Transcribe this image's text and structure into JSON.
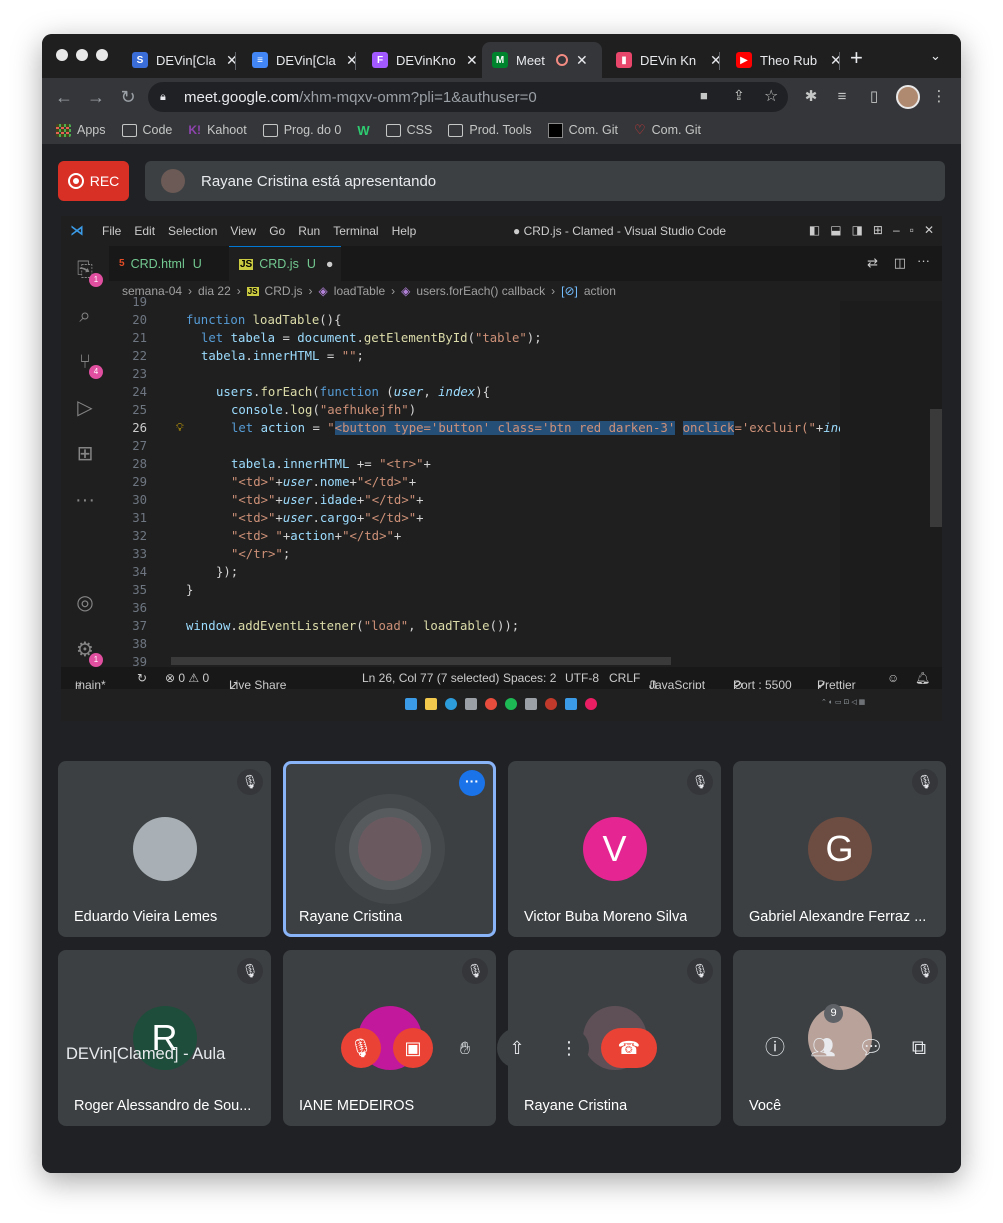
{
  "browser": {
    "tabs": [
      {
        "title": "DEVin[Cla",
        "favicon_color": "#3b6dd8",
        "favicon_glyph": "S"
      },
      {
        "title": "DEVin[Cla",
        "favicon_color": "#4285f4",
        "favicon_glyph": "≡"
      },
      {
        "title": "DEVinKno",
        "favicon_color": "#a259ff",
        "favicon_glyph": "F"
      },
      {
        "title": "Meet",
        "favicon_color": "#00832d",
        "favicon_glyph": "M"
      },
      {
        "title": "DEVin Kn",
        "favicon_color": "#e8476b",
        "favicon_glyph": "▮"
      },
      {
        "title": "Theo Rub",
        "favicon_color": "#ff0000",
        "favicon_glyph": "▶"
      }
    ],
    "new_tab": "+",
    "url_host": "meet.google.com",
    "url_path": "/xhm-mqxv-omm?pli=1&authuser=0",
    "bookmarks": [
      "Apps",
      "Code",
      "Kahoot",
      "Prog. do 0",
      "",
      "CSS",
      "Prod. Tools",
      "Com. Git",
      "Com. Git"
    ]
  },
  "meet": {
    "rec_label": "REC",
    "presenting_text": "Rayane Cristina está apresentando",
    "meeting_name": "DEVin[Clamed] - Aula",
    "participant_count": "9",
    "participants": [
      {
        "name": "Eduardo Vieira Lemes",
        "initial": "",
        "color": "#a8b0b5"
      },
      {
        "name": "Rayane Cristina",
        "initial": "",
        "color": "#6a5a60"
      },
      {
        "name": "Victor Buba Moreno Silva",
        "initial": "V",
        "color": "#e52592"
      },
      {
        "name": "Gabriel Alexandre Ferraz ...",
        "initial": "G",
        "color": "#6d4c41"
      },
      {
        "name": "Roger Alessandro de Sou...",
        "initial": "R",
        "color": "#1e4d3b"
      },
      {
        "name": "IANE MEDEIROS",
        "initial": "",
        "color": "#c2189b"
      },
      {
        "name": "Rayane Cristina",
        "initial": "",
        "color": "#5e5056"
      },
      {
        "name": "Você",
        "initial": "",
        "color": "#b8a29a"
      }
    ]
  },
  "vscode": {
    "menu": [
      "File",
      "Edit",
      "Selection",
      "View",
      "Go",
      "Run",
      "Terminal",
      "Help"
    ],
    "window_title": "● CRD.js - Clamed - Visual Studio Code",
    "tabs": [
      {
        "label": "CRD.html",
        "status": "U",
        "icon": "5"
      },
      {
        "label": "CRD.js",
        "status": "U",
        "icon": "JS"
      }
    ],
    "breadcrumb": [
      "semana-04",
      "dia 22",
      "CRD.js",
      "loadTable",
      "users.forEach() callback",
      "action"
    ],
    "status": {
      "branch": "main*",
      "problems": "⊗ 0 ⚠ 0",
      "live_share": "Live Share",
      "cursor": "Ln 26, Col 77 (7 selected)",
      "spaces": "Spaces: 2",
      "encoding": "UTF-8",
      "eol": "CRLF",
      "language": "JavaScript",
      "port": "Port : 5500",
      "prettier": "Prettier"
    },
    "line_numbers": [
      "19",
      "20",
      "21",
      "22",
      "23",
      "24",
      "25",
      "26",
      "27",
      "28",
      "29",
      "30",
      "31",
      "32",
      "33",
      "34",
      "35",
      "36",
      "37",
      "38",
      "39"
    ],
    "badges": {
      "explorer": "1",
      "scm": "4",
      "settings": "1"
    }
  }
}
